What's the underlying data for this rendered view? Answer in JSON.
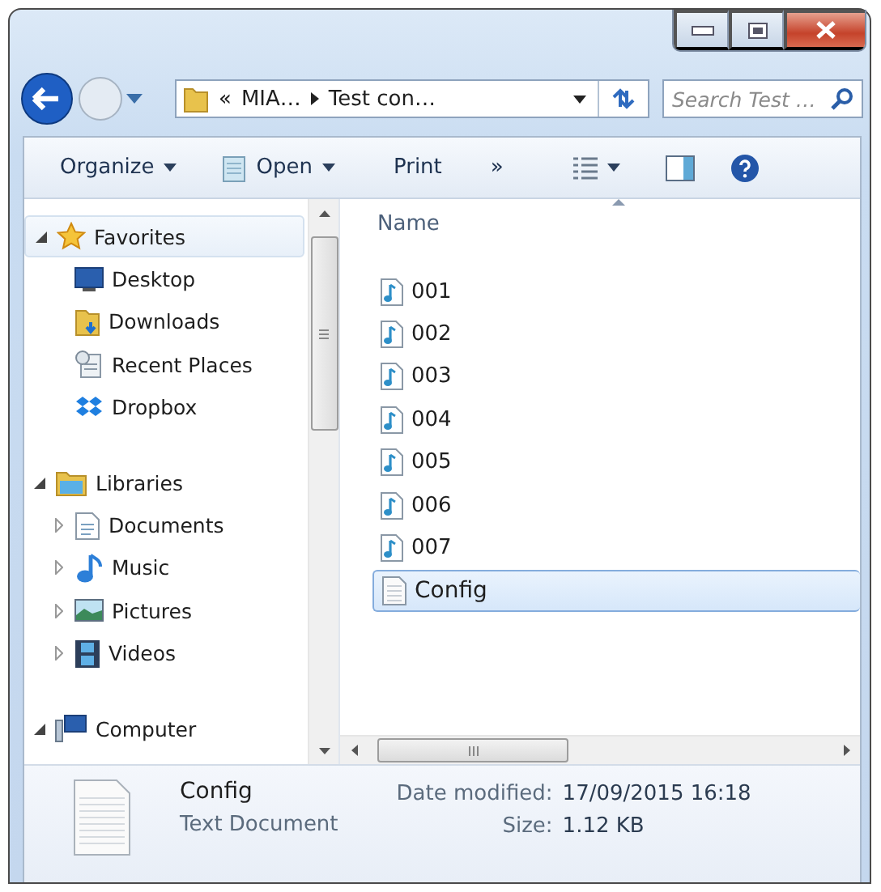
{
  "address_bar": {
    "segments": [
      "«",
      "MIA…",
      "Test con…"
    ]
  },
  "search": {
    "placeholder": "Search Test …"
  },
  "toolbar": [
    {
      "label": "Organize",
      "kind": "menu"
    },
    {
      "label": "Open",
      "kind": "open"
    },
    {
      "label": "Print",
      "kind": "button"
    },
    {
      "label": "»",
      "kind": "overflow"
    },
    {
      "kind": "views"
    },
    {
      "kind": "preview"
    },
    {
      "kind": "help"
    }
  ],
  "navigation": [
    {
      "label": "Favorites",
      "kind": "star",
      "expanded": true,
      "selected": true,
      "children": [
        {
          "label": "Desktop",
          "kind": "desktop",
          "selected": false
        },
        {
          "label": "Downloads",
          "kind": "downloads",
          "selected": false
        },
        {
          "label": "Recent Places",
          "kind": "recent",
          "selected": false
        },
        {
          "label": "Dropbox",
          "kind": "dropbox",
          "selected": false
        }
      ]
    },
    {
      "label": "Libraries",
      "kind": "library",
      "expanded": true,
      "selected": false,
      "children": [
        {
          "label": "Documents",
          "kind": "documents",
          "expanded": false,
          "selected": false
        },
        {
          "label": "Music",
          "kind": "music",
          "expanded": false,
          "selected": false
        },
        {
          "label": "Pictures",
          "kind": "pictures",
          "expanded": false,
          "selected": false
        },
        {
          "label": "Videos",
          "kind": "videos",
          "expanded": false,
          "selected": false
        }
      ]
    },
    {
      "label": "Computer",
      "kind": "computer",
      "expanded": true,
      "selected": false
    }
  ],
  "file_list": {
    "columns": [
      "Name"
    ],
    "files": [
      {
        "name": "001",
        "kind": "audio",
        "selected": false
      },
      {
        "name": "002",
        "kind": "audio",
        "selected": false
      },
      {
        "name": "003",
        "kind": "audio",
        "selected": false
      },
      {
        "name": "004",
        "kind": "audio",
        "selected": false
      },
      {
        "name": "005",
        "kind": "audio",
        "selected": false
      },
      {
        "name": "006",
        "kind": "audio",
        "selected": false
      },
      {
        "name": "007",
        "kind": "audio",
        "selected": false
      },
      {
        "name": "Config",
        "kind": "text",
        "selected": true
      }
    ]
  },
  "details": {
    "name": "Config",
    "type": "Text Document",
    "fields": [
      {
        "label": "Date modified:",
        "value": "17/09/2015 16:18"
      },
      {
        "label": "Size:",
        "value": "1.12 KB"
      }
    ]
  }
}
